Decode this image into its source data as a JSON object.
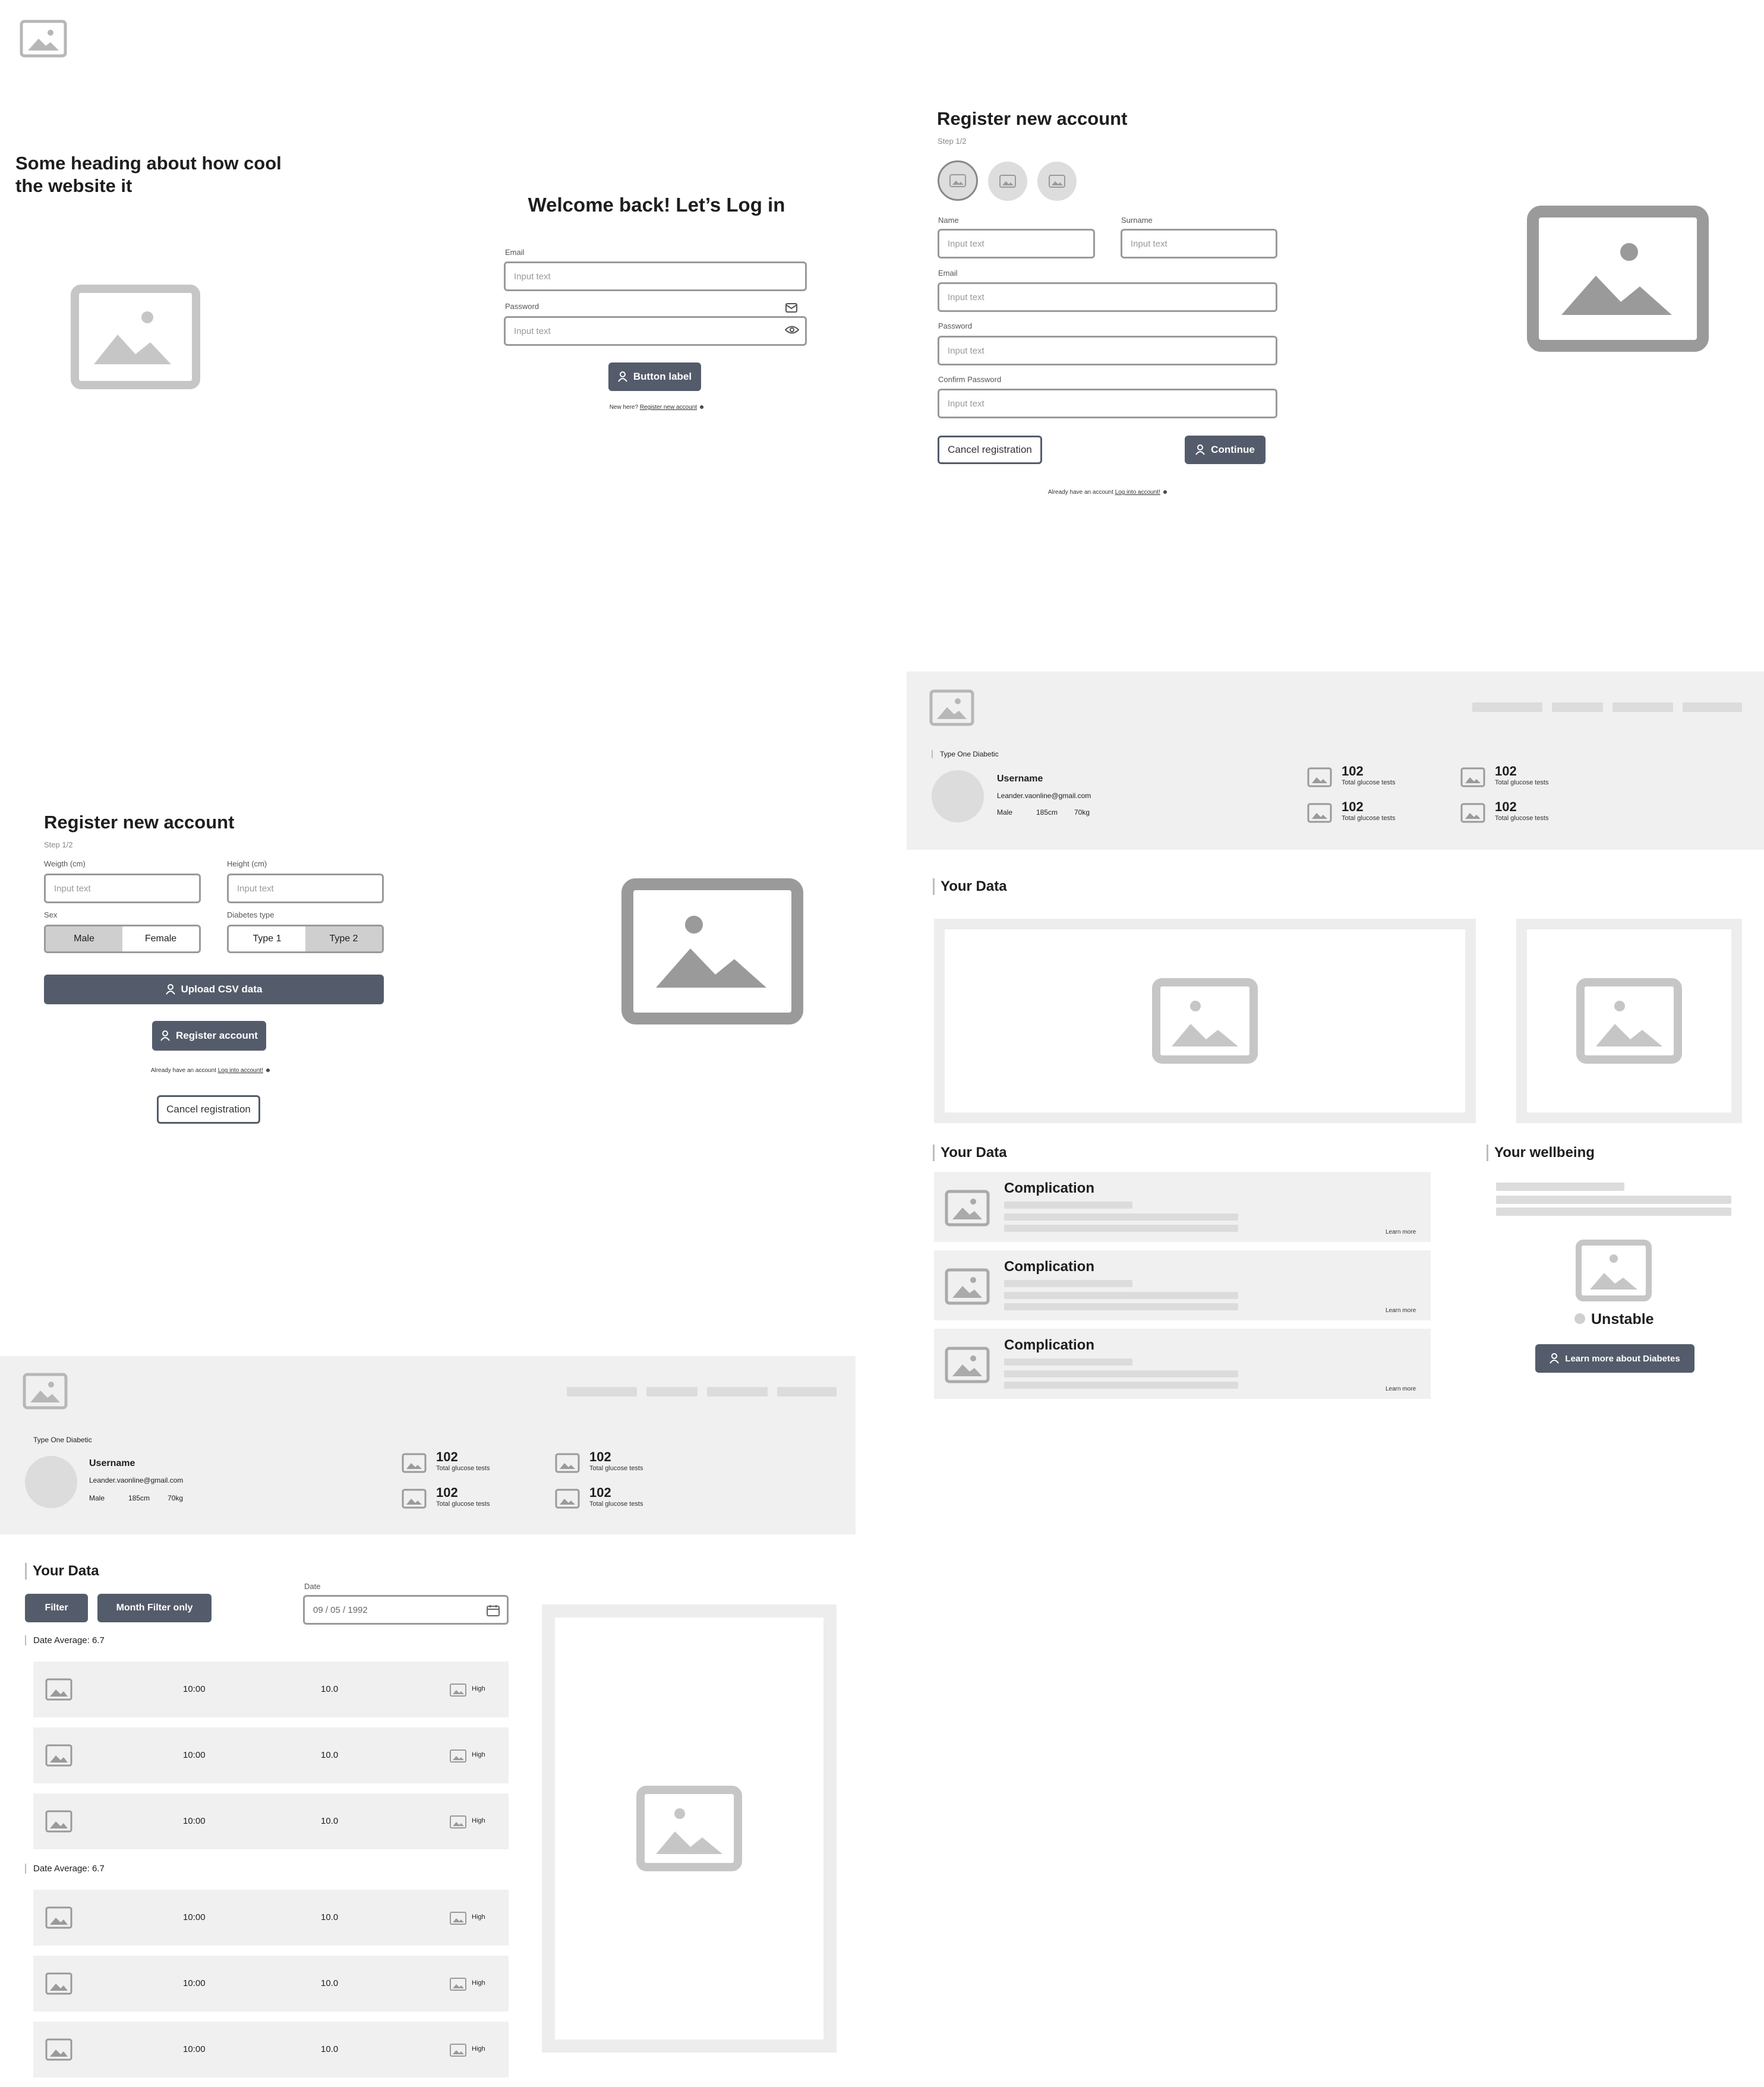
{
  "landing": {
    "logo_icon": "image-icon",
    "heading_line1": "Some heading about how cool",
    "heading_line2": "the website it"
  },
  "login": {
    "title": "Welcome back! Let’s Log in",
    "email_label": "Email",
    "email_placeholder": "Input text",
    "password_label": "Password",
    "password_placeholder": "Input text",
    "button": "Button label",
    "new_here": "New here?",
    "register_link": "Register new account"
  },
  "register1": {
    "title": "Register new account",
    "step": "Step 1/2",
    "name_label": "Name",
    "surname_label": "Surname",
    "email_label": "Email",
    "password_label": "Password",
    "confirm_label": "Confirm Password",
    "placeholder": "Input text",
    "cancel": "Cancel registration",
    "continue": "Continue",
    "already": "Already have an account",
    "login_link": "Log into account!"
  },
  "register2": {
    "title": "Register new account",
    "step": "Step 1/2",
    "weight_label": "Weigth (cm)",
    "height_label": "Height (cm)",
    "placeholder": "Input text",
    "sex_label": "Sex",
    "sex_options": [
      "Male",
      "Female"
    ],
    "diabetes_label": "Diabetes type",
    "diabetes_options": [
      "Type 1",
      "Type 2"
    ],
    "upload": "Upload CSV data",
    "register": "Register account",
    "already": "Already have an account",
    "login_link": "Log into account!",
    "cancel": "Cancel registration"
  },
  "profile": {
    "type": "Type One Diabetic",
    "username": "Username",
    "email": "Leander.vaonline@gmail.com",
    "sex": "Male",
    "height": "185cm",
    "weight": "70kg",
    "stat_value": "102",
    "stat_label": "Total glucose tests"
  },
  "dashboard": {
    "your_data": "Your Data",
    "your_wellbeing": "Your wellbeing",
    "complication": "Complication",
    "learn_more": "Learn more",
    "status": "Unstable",
    "learn_button": "Learn more about Diabetes"
  },
  "datapage": {
    "your_data": "Your Data",
    "filter": "Filter",
    "month_filter": "Month Filter only",
    "date_label": "Date",
    "date_value": "09 / 05 / 1992",
    "groups": [
      {
        "average": "Date Average: 6.7",
        "rows": [
          {
            "time": "10:00",
            "value": "10.0",
            "level": "High"
          },
          {
            "time": "10:00",
            "value": "10.0",
            "level": "High"
          },
          {
            "time": "10:00",
            "value": "10.0",
            "level": "High"
          }
        ]
      },
      {
        "average": "Date Average: 6.7",
        "rows": [
          {
            "time": "10:00",
            "value": "10.0",
            "level": "High"
          },
          {
            "time": "10:00",
            "value": "10.0",
            "level": "High"
          },
          {
            "time": "10:00",
            "value": "10.0",
            "level": "High"
          }
        ]
      }
    ]
  },
  "colors": {
    "accent": "#545c6b",
    "placeholder": "#9a9a9a",
    "panel": "#f1f0f0"
  }
}
